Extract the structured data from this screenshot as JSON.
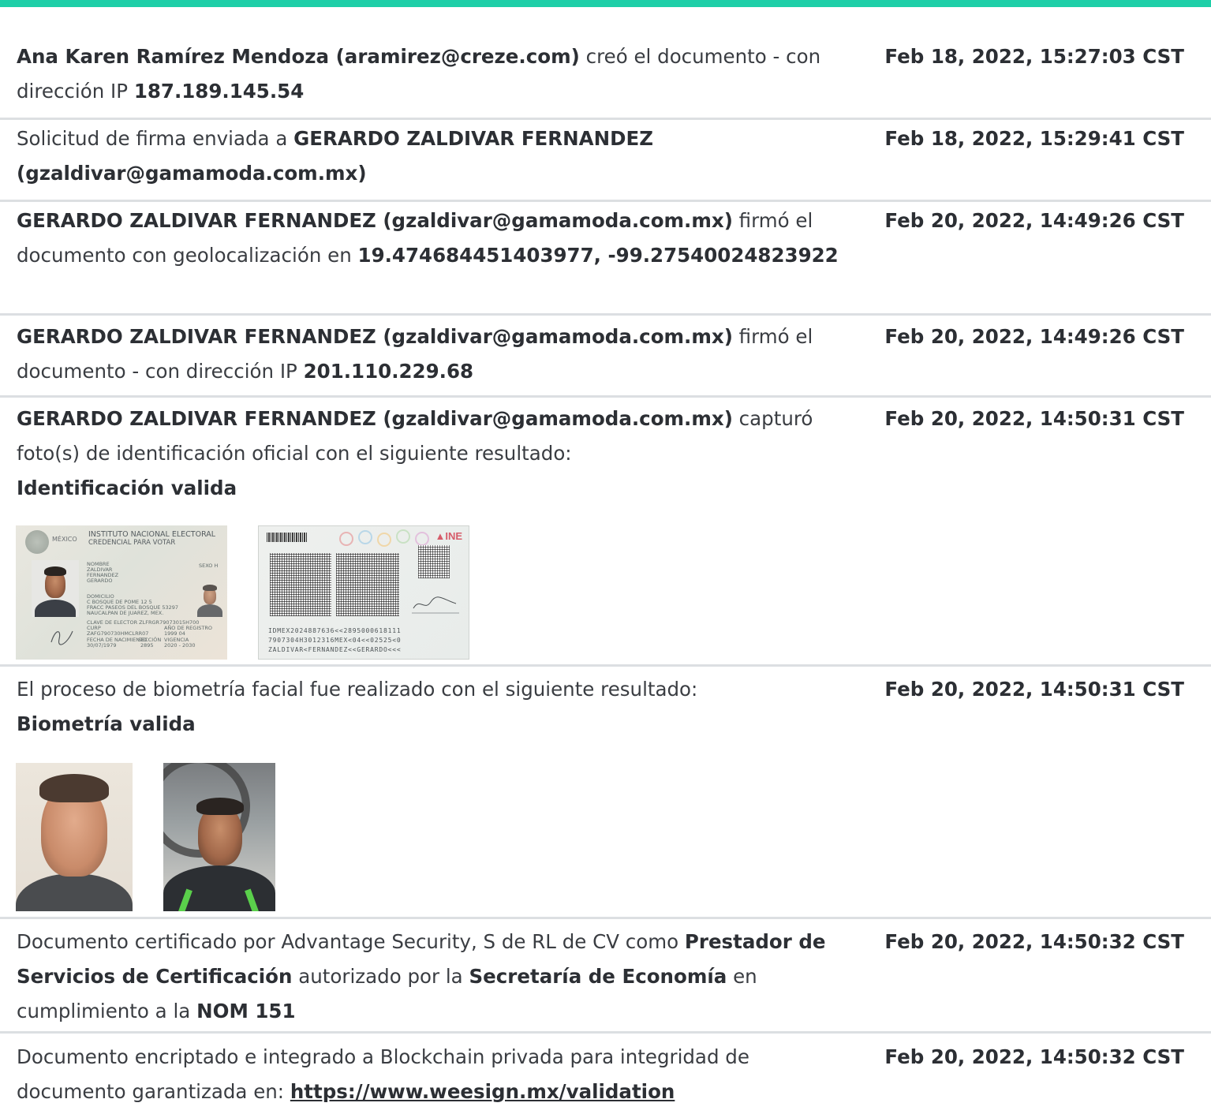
{
  "colors": {
    "accent": "#1ecfa8",
    "separator": "#dcdfe2"
  },
  "entries": [
    {
      "actor": "Ana Karen Ramírez Mendoza (aramirez@creze.com)",
      "action": " creó el documento - con dirección IP ",
      "ip": "187.189.145.54",
      "date": "Feb 18, 2022, 15:27:03 CST"
    },
    {
      "text": "Solicitud de firma enviada a ",
      "recipient": "GERARDO ZALDIVAR FERNANDEZ (gzaldivar@gamamoda.com.mx)",
      "date": "Feb 18, 2022, 15:29:41 CST"
    },
    {
      "actor": "GERARDO ZALDIVAR FERNANDEZ (gzaldivar@gamamoda.com.mx)",
      "action": " firmó el documento con geolocalización en ",
      "geo": "19.474684451403977, -99.27540024823922",
      "date": "Feb 20, 2022, 14:49:26 CST"
    },
    {
      "actor": "GERARDO ZALDIVAR FERNANDEZ (gzaldivar@gamamoda.com.mx)",
      "action": " firmó el documento - con dirección IP ",
      "ip": "201.110.229.68",
      "date": "Feb 20, 2022, 14:49:26 CST"
    },
    {
      "actor": "GERARDO ZALDIVAR FERNANDEZ (gzaldivar@gamamoda.com.mx)",
      "action": " capturó foto(s) de identificación oficial con el siguiente resultado:",
      "result": "Identificación valida",
      "date": "Feb 20, 2022, 14:50:31 CST",
      "id_front": {
        "country": "MÉXICO",
        "institute": "INSTITUTO NACIONAL ELECTORAL",
        "credential": "CREDENCIAL PARA VOTAR",
        "name_label": "NOMBRE",
        "name_lines": [
          "ZALDIVAR",
          "FERNANDEZ",
          "GERARDO"
        ],
        "sex": "SEXO H",
        "address_label": "DOMICILIO",
        "address_lines": [
          "C BOSQUE DE POME 12 5",
          "FRACC PASEOS DEL BOSQUE 53297",
          "NAUCALPAN DE JUAREZ, MEX."
        ],
        "elector_key": "CLAVE DE ELECTOR  ZLFRGR79073015H700",
        "curp": "CURP",
        "curp_value": "ZAFG790730HMCLRR07",
        "registro": "AÑO DE REGISTRO",
        "registro_value": "1999 04",
        "birth_label": "FECHA DE NACIMIENTO",
        "birth_value": "30/07/1979",
        "section_label": "SECCIÓN",
        "section_value": "2895",
        "validity_label": "VIGENCIA",
        "validity_value": "2020 - 2030"
      },
      "id_back": {
        "brand": "INE",
        "mrz": [
          "IDMEX2024887636<<2895000618111",
          "7907304H3012316MEX<04<<02525<0",
          "ZALDIVAR<FERNANDEZ<<GERARDO<<<"
        ]
      }
    },
    {
      "text": "El proceso de biometría facial fue realizado con el siguiente resultado:",
      "result": "Biometría valida",
      "date": "Feb 20, 2022, 14:50:31 CST"
    },
    {
      "t1": "Documento certificado por Advantage Security, S de RL de CV como ",
      "b1": "Prestador de Servicios de Certificación",
      "t2": " autorizado por la ",
      "b2": "Secretaría de Economía",
      "t3": " en cumplimiento a la ",
      "b3": "NOM 151",
      "date": "Feb 20, 2022, 14:50:32 CST"
    },
    {
      "text": "Documento encriptado e integrado a Blockchain privada para integridad de documento garantizada en: ",
      "link": "https://www.weesign.mx/validation",
      "date": "Feb 20, 2022, 14:50:32 CST"
    }
  ]
}
